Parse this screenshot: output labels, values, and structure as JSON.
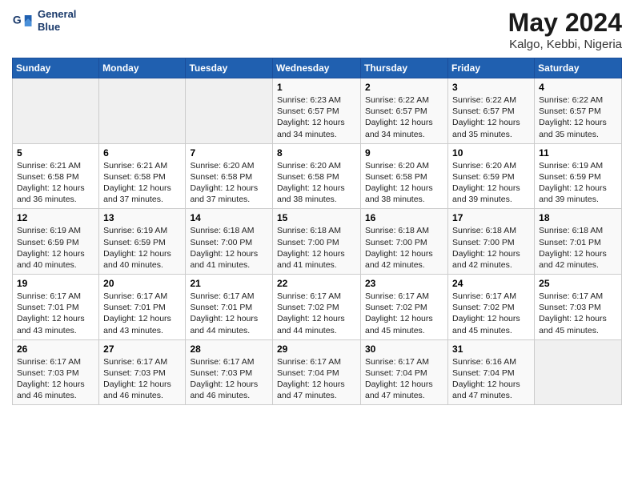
{
  "header": {
    "logo_line1": "General",
    "logo_line2": "Blue",
    "month": "May 2024",
    "location": "Kalgo, Kebbi, Nigeria"
  },
  "weekdays": [
    "Sunday",
    "Monday",
    "Tuesday",
    "Wednesday",
    "Thursday",
    "Friday",
    "Saturday"
  ],
  "weeks": [
    [
      {
        "day": "",
        "info": ""
      },
      {
        "day": "",
        "info": ""
      },
      {
        "day": "",
        "info": ""
      },
      {
        "day": "1",
        "info": "Sunrise: 6:23 AM\nSunset: 6:57 PM\nDaylight: 12 hours\nand 34 minutes."
      },
      {
        "day": "2",
        "info": "Sunrise: 6:22 AM\nSunset: 6:57 PM\nDaylight: 12 hours\nand 34 minutes."
      },
      {
        "day": "3",
        "info": "Sunrise: 6:22 AM\nSunset: 6:57 PM\nDaylight: 12 hours\nand 35 minutes."
      },
      {
        "day": "4",
        "info": "Sunrise: 6:22 AM\nSunset: 6:57 PM\nDaylight: 12 hours\nand 35 minutes."
      }
    ],
    [
      {
        "day": "5",
        "info": "Sunrise: 6:21 AM\nSunset: 6:58 PM\nDaylight: 12 hours\nand 36 minutes."
      },
      {
        "day": "6",
        "info": "Sunrise: 6:21 AM\nSunset: 6:58 PM\nDaylight: 12 hours\nand 37 minutes."
      },
      {
        "day": "7",
        "info": "Sunrise: 6:20 AM\nSunset: 6:58 PM\nDaylight: 12 hours\nand 37 minutes."
      },
      {
        "day": "8",
        "info": "Sunrise: 6:20 AM\nSunset: 6:58 PM\nDaylight: 12 hours\nand 38 minutes."
      },
      {
        "day": "9",
        "info": "Sunrise: 6:20 AM\nSunset: 6:58 PM\nDaylight: 12 hours\nand 38 minutes."
      },
      {
        "day": "10",
        "info": "Sunrise: 6:20 AM\nSunset: 6:59 PM\nDaylight: 12 hours\nand 39 minutes."
      },
      {
        "day": "11",
        "info": "Sunrise: 6:19 AM\nSunset: 6:59 PM\nDaylight: 12 hours\nand 39 minutes."
      }
    ],
    [
      {
        "day": "12",
        "info": "Sunrise: 6:19 AM\nSunset: 6:59 PM\nDaylight: 12 hours\nand 40 minutes."
      },
      {
        "day": "13",
        "info": "Sunrise: 6:19 AM\nSunset: 6:59 PM\nDaylight: 12 hours\nand 40 minutes."
      },
      {
        "day": "14",
        "info": "Sunrise: 6:18 AM\nSunset: 7:00 PM\nDaylight: 12 hours\nand 41 minutes."
      },
      {
        "day": "15",
        "info": "Sunrise: 6:18 AM\nSunset: 7:00 PM\nDaylight: 12 hours\nand 41 minutes."
      },
      {
        "day": "16",
        "info": "Sunrise: 6:18 AM\nSunset: 7:00 PM\nDaylight: 12 hours\nand 42 minutes."
      },
      {
        "day": "17",
        "info": "Sunrise: 6:18 AM\nSunset: 7:00 PM\nDaylight: 12 hours\nand 42 minutes."
      },
      {
        "day": "18",
        "info": "Sunrise: 6:18 AM\nSunset: 7:01 PM\nDaylight: 12 hours\nand 42 minutes."
      }
    ],
    [
      {
        "day": "19",
        "info": "Sunrise: 6:17 AM\nSunset: 7:01 PM\nDaylight: 12 hours\nand 43 minutes."
      },
      {
        "day": "20",
        "info": "Sunrise: 6:17 AM\nSunset: 7:01 PM\nDaylight: 12 hours\nand 43 minutes."
      },
      {
        "day": "21",
        "info": "Sunrise: 6:17 AM\nSunset: 7:01 PM\nDaylight: 12 hours\nand 44 minutes."
      },
      {
        "day": "22",
        "info": "Sunrise: 6:17 AM\nSunset: 7:02 PM\nDaylight: 12 hours\nand 44 minutes."
      },
      {
        "day": "23",
        "info": "Sunrise: 6:17 AM\nSunset: 7:02 PM\nDaylight: 12 hours\nand 45 minutes."
      },
      {
        "day": "24",
        "info": "Sunrise: 6:17 AM\nSunset: 7:02 PM\nDaylight: 12 hours\nand 45 minutes."
      },
      {
        "day": "25",
        "info": "Sunrise: 6:17 AM\nSunset: 7:03 PM\nDaylight: 12 hours\nand 45 minutes."
      }
    ],
    [
      {
        "day": "26",
        "info": "Sunrise: 6:17 AM\nSunset: 7:03 PM\nDaylight: 12 hours\nand 46 minutes."
      },
      {
        "day": "27",
        "info": "Sunrise: 6:17 AM\nSunset: 7:03 PM\nDaylight: 12 hours\nand 46 minutes."
      },
      {
        "day": "28",
        "info": "Sunrise: 6:17 AM\nSunset: 7:03 PM\nDaylight: 12 hours\nand 46 minutes."
      },
      {
        "day": "29",
        "info": "Sunrise: 6:17 AM\nSunset: 7:04 PM\nDaylight: 12 hours\nand 47 minutes."
      },
      {
        "day": "30",
        "info": "Sunrise: 6:17 AM\nSunset: 7:04 PM\nDaylight: 12 hours\nand 47 minutes."
      },
      {
        "day": "31",
        "info": "Sunrise: 6:16 AM\nSunset: 7:04 PM\nDaylight: 12 hours\nand 47 minutes."
      },
      {
        "day": "",
        "info": ""
      }
    ]
  ]
}
